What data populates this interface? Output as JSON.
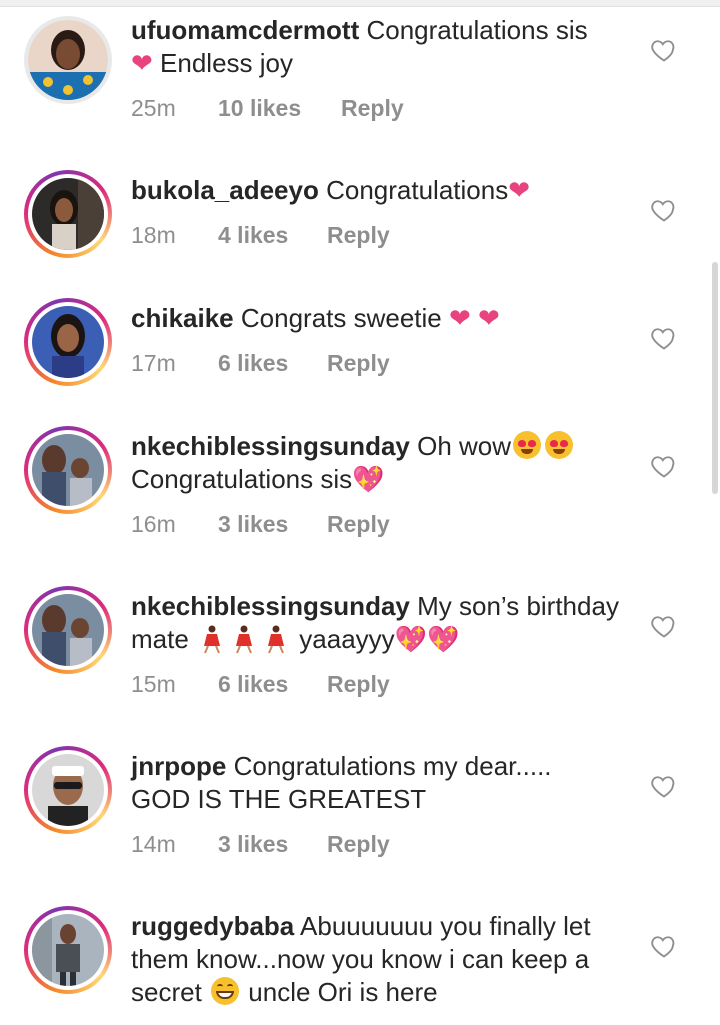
{
  "comments": [
    {
      "username": "ufuomamcdermott",
      "line1": "Congratulations sis",
      "line2_heart": "❤",
      "line2": "Endless joy",
      "time": "25m",
      "likes": "10 likes",
      "reply": "Reply"
    },
    {
      "username": "bukola_adeeyo",
      "line1": "Congratulations",
      "heart": "❤",
      "time": "18m",
      "likes": "4 likes",
      "reply": "Reply"
    },
    {
      "username": "chikaike",
      "line1": "Congrats sweetie",
      "hearts": "❤ ❤",
      "time": "17m",
      "likes": "6 likes",
      "reply": "Reply"
    },
    {
      "username": "nkechiblessingsunday",
      "line1": "Oh wow",
      "line2": "Congratulations sis",
      "heart": "💖",
      "time": "16m",
      "likes": "3 likes",
      "reply": "Reply"
    },
    {
      "username": "nkechiblessingsunday",
      "line1": "My son’s birthday",
      "line2a": "mate",
      "line2b": "yaaayyy",
      "hearts": "💖💖",
      "time": "15m",
      "likes": "6 likes",
      "reply": "Reply"
    },
    {
      "username": "jnrpope",
      "line1": "Congratulations my dear.....",
      "line2": "GOD IS THE GREATEST",
      "time": "14m",
      "likes": "3 likes",
      "reply": "Reply"
    },
    {
      "username": "ruggedybaba",
      "line1": "Abuuuuuuu you finally let",
      "line2": "them know...now you know i can keep a",
      "line3a": "secret",
      "line3b": "uncle Ori is here"
    }
  ],
  "icons": {
    "like": "heart-outline-icon",
    "heart_color": "#e8437f",
    "ring_gradient": [
      "#f58529",
      "#dd2a7b",
      "#8134af"
    ]
  }
}
